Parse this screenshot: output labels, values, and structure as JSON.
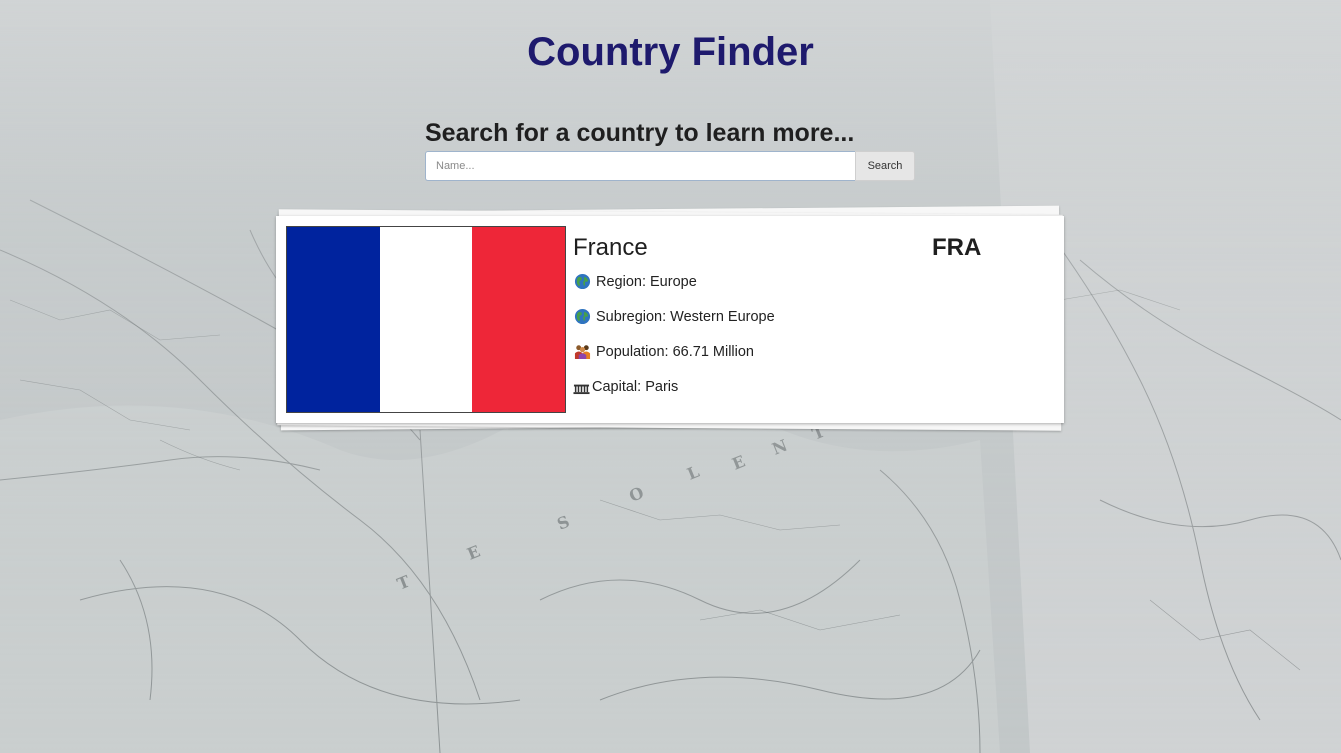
{
  "page": {
    "title": "Country Finder",
    "accent_color": "#1e1a6d"
  },
  "search": {
    "heading": "Search for a country to learn more...",
    "placeholder": "Name...",
    "value": "",
    "button_label": "Search"
  },
  "country": {
    "name": "France",
    "code": "FRA",
    "flag_colors": [
      "#00239e",
      "#ffffff",
      "#ee2638"
    ],
    "region_label": "Region:",
    "region": "Europe",
    "region_icon": "globe-icon",
    "subregion_label": "Subregion:",
    "subregion": "Western Europe",
    "subregion_icon": "globe-icon",
    "population_label": "Population:",
    "population": "66.71 Million",
    "population_icon": "people-icon",
    "capital_label": "Capital:",
    "capital": "Paris",
    "capital_icon": "capitol-building-icon"
  }
}
